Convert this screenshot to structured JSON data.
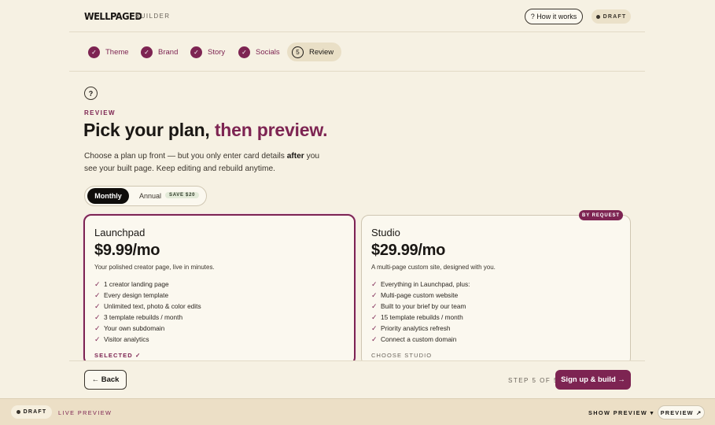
{
  "header": {
    "logo": "WELLPAGED",
    "builder_label": "BUILDER",
    "how_it_works": "? How it works",
    "draft_label": "DRAFT"
  },
  "steps": [
    {
      "label": "Theme",
      "icon": "check-icon",
      "done": true
    },
    {
      "label": "Brand",
      "icon": "check-icon",
      "done": true
    },
    {
      "label": "Story",
      "icon": "check-icon",
      "done": true
    },
    {
      "label": "Socials",
      "icon": "check-icon",
      "done": true
    },
    {
      "label": "Review",
      "number": "5",
      "done": false
    }
  ],
  "main": {
    "help_icon": "?",
    "eyebrow": "REVIEW",
    "title_part1": "Pick your plan,",
    "title_part2": "then preview.",
    "lede_part1": "Choose a plan up front — but you only enter card details",
    "lede_bold": "after",
    "lede_part2": "you see your built page. Keep editing and rebuild anytime."
  },
  "billing_toggle": {
    "monthly": "Monthly",
    "annual": "Annual",
    "save_badge": "SAVE $20",
    "selected": "Monthly"
  },
  "plans": [
    {
      "name": "Launchpad",
      "price": "$9.99/mo",
      "description": "Your polished creator page, live in minutes.",
      "features": [
        "1 creator landing page",
        "Every design template",
        "Unlimited text, photo & color edits",
        "3 template rebuilds / month",
        "Your own subdomain",
        "Visitor analytics"
      ],
      "status": "SELECTED ✓"
    },
    {
      "name": "Studio",
      "price": "$29.99/mo",
      "description": "A multi-page custom site, designed with you.",
      "badge": "BY REQUEST",
      "features": [
        "Everything in Launchpad, plus:",
        "Multi-page custom website",
        "Built to your brief by our team",
        "15 template rebuilds / month",
        "Priority analytics refresh",
        "Connect a custom domain"
      ],
      "status": "CHOOSE STUDIO"
    }
  ],
  "footer": {
    "back": "← Back",
    "step_counter": "STEP 5 OF 5",
    "signup": "Sign up & build →"
  },
  "bottom_bar": {
    "draft": "DRAFT",
    "live_preview": "LIVE PREVIEW",
    "show_preview": "SHOW PREVIEW ▾",
    "preview": "PREVIEW ↗"
  },
  "colors": {
    "accent": "#7d2452",
    "background": "#F6F1E3"
  }
}
